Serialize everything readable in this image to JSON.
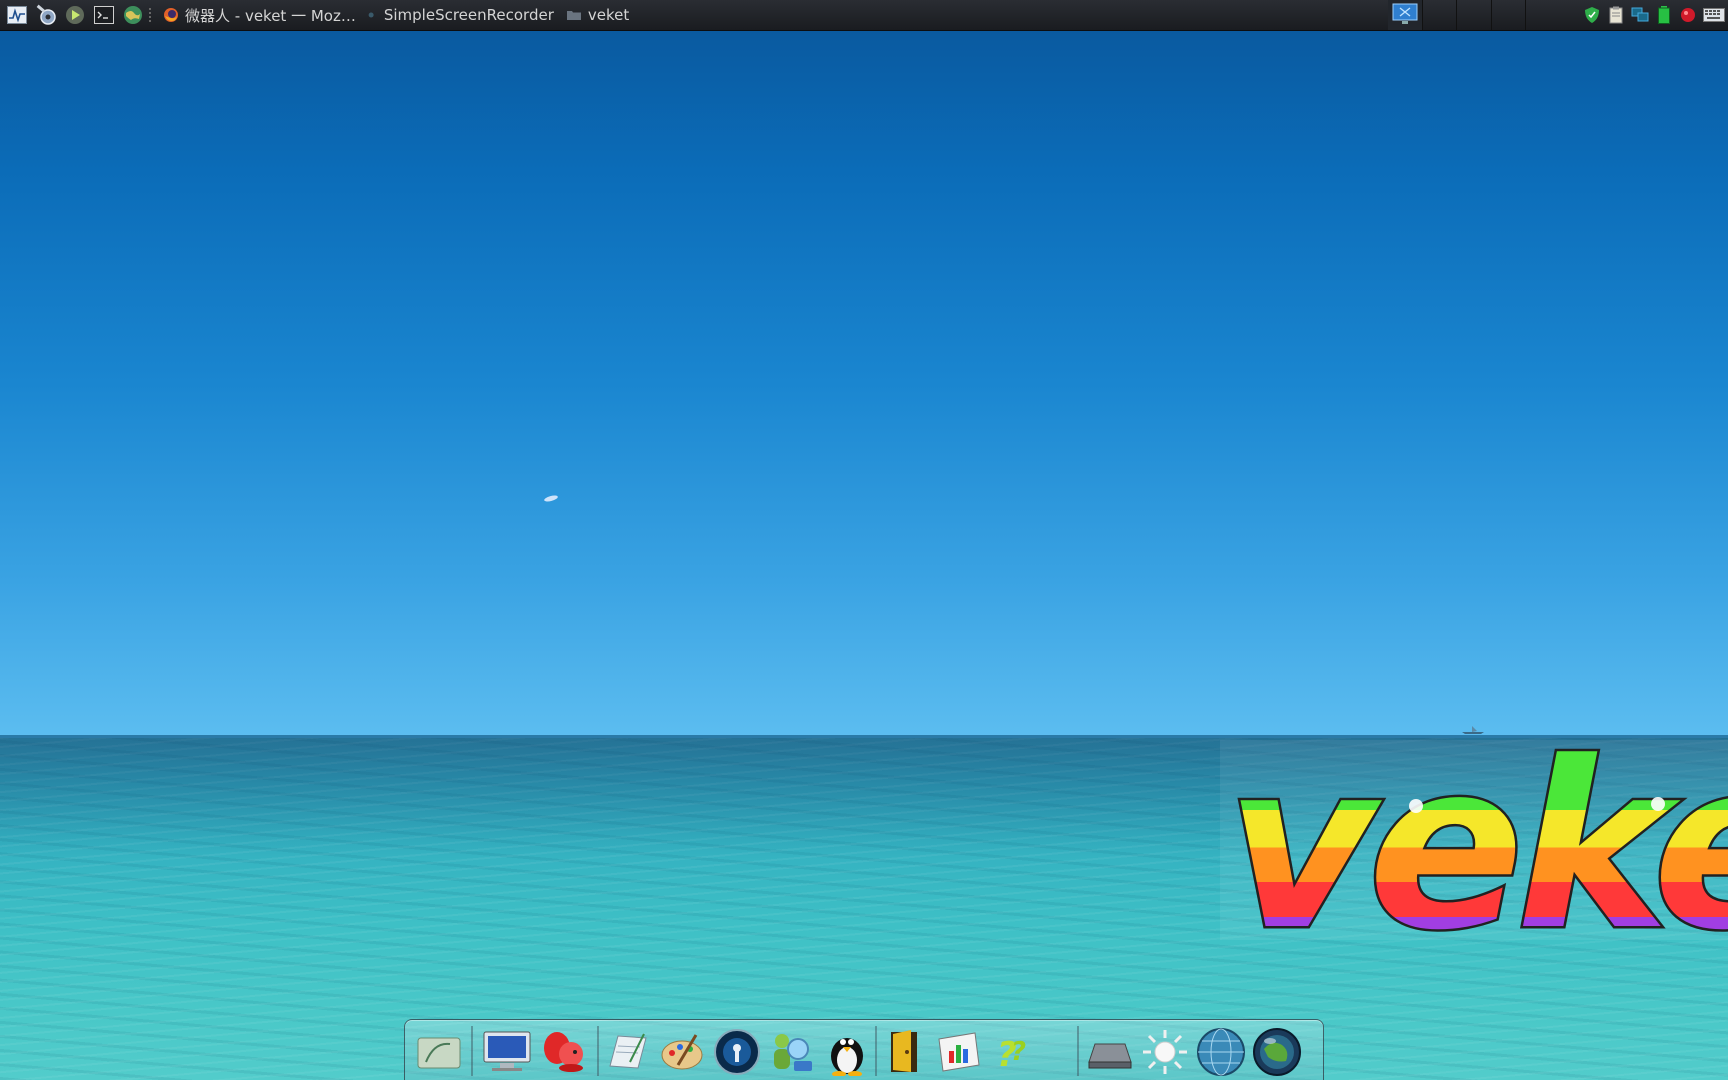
{
  "top_panel": {
    "tasks": [
      {
        "label": "微器人 - veket 一 Moz…",
        "icon": "firefox-icon"
      },
      {
        "label": "SimpleScreenRecorder",
        "icon": "recorder-icon"
      },
      {
        "label": "veket",
        "icon": "folder-icon"
      }
    ],
    "launchers": [
      "system-monitor-icon",
      "settings-icon",
      "run-icon",
      "terminal-icon",
      "browser-globe-icon"
    ],
    "tray": [
      "shield-icon",
      "clipboard-icon",
      "network-icon",
      "battery-icon",
      "record-icon",
      "keyboard-icon"
    ]
  },
  "desktop": {
    "logo_text": "veket"
  },
  "dock": {
    "items": [
      "file-manager-icon",
      "computer-icon",
      "squirrel-icon",
      "text-editor-icon",
      "paint-icon",
      "media-player-icon",
      "users-search-icon",
      "penguin-icon",
      "door-exit-icon",
      "chart-app-icon",
      "help-icon",
      "drive-icon",
      "brightness-icon",
      "globe-icon",
      "sphere-icon"
    ]
  },
  "colors": {
    "panel": "#1e2025",
    "sky_top": "#0a5aa0",
    "sky_bottom": "#5cbdf0",
    "sea": "#3ec0c6"
  }
}
